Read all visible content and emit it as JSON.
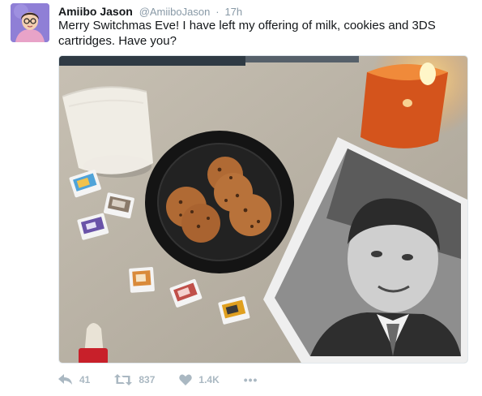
{
  "tweet": {
    "display_name": "Amiibo Jason",
    "handle": "@AmiiboJason",
    "separator": "·",
    "timestamp": "17h",
    "text": "Merry Switchmas Eve! I have left my offering of milk, cookies and 3DS cartridges. Have you?",
    "media_icon": "photo-milk-cookies-3ds-cartridges-portrait-candle"
  },
  "actions": {
    "reply": {
      "icon": "reply-icon",
      "count": "41"
    },
    "retweet": {
      "icon": "retweet-icon",
      "count": "837"
    },
    "like": {
      "icon": "heart-icon",
      "count": "1.4K"
    },
    "more": {
      "icon": "more-icon",
      "label": "•••"
    }
  },
  "colors": {
    "text": "#14171a",
    "muted": "#8899a6",
    "action_icon": "#aab8c2",
    "avatar_bg": "#8f7fd6"
  }
}
